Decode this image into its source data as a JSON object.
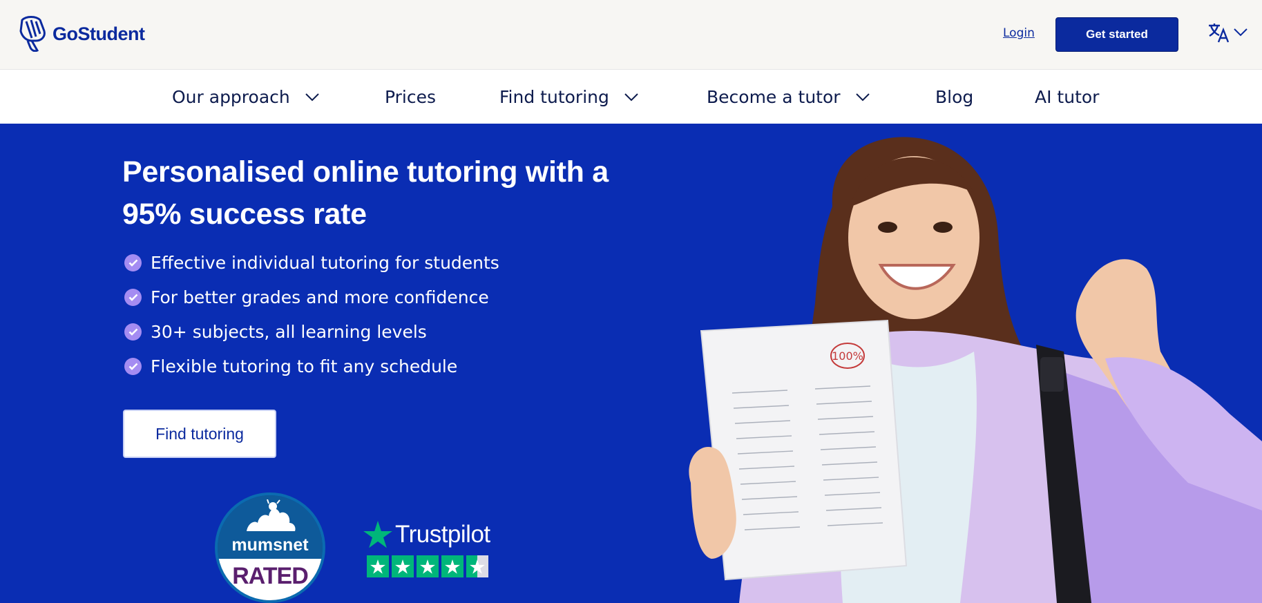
{
  "header": {
    "logo_text": "GoStudent",
    "login_label": "Login",
    "cta_label": "Get started",
    "language_icon": "translate-icon"
  },
  "nav": {
    "items": [
      {
        "label": "Our approach",
        "has_dropdown": true
      },
      {
        "label": "Prices",
        "has_dropdown": false
      },
      {
        "label": "Find tutoring",
        "has_dropdown": true
      },
      {
        "label": "Become a tutor",
        "has_dropdown": true
      },
      {
        "label": "Blog",
        "has_dropdown": false
      },
      {
        "label": "AI tutor",
        "has_dropdown": false
      }
    ]
  },
  "hero": {
    "headline": "Personalised online tutoring with a 95% success rate",
    "features": [
      "Effective individual tutoring for students",
      "For better grades and more confidence",
      "30+ subjects, all learning levels",
      "Flexible tutoring to fit any schedule"
    ],
    "cta_label": "Find tutoring",
    "badges": {
      "mumsnet_word": "mumsnet",
      "mumsnet_rated": "RATED",
      "trustpilot_word": "Trustpilot",
      "trustpilot_rating": 4.5
    },
    "paper_score": "100%"
  },
  "colors": {
    "brand_blue": "#0a2db3",
    "topbar_bg": "#f7f6f3",
    "check_purple": "#a48cf2",
    "trustpilot_green": "#00b67a"
  }
}
